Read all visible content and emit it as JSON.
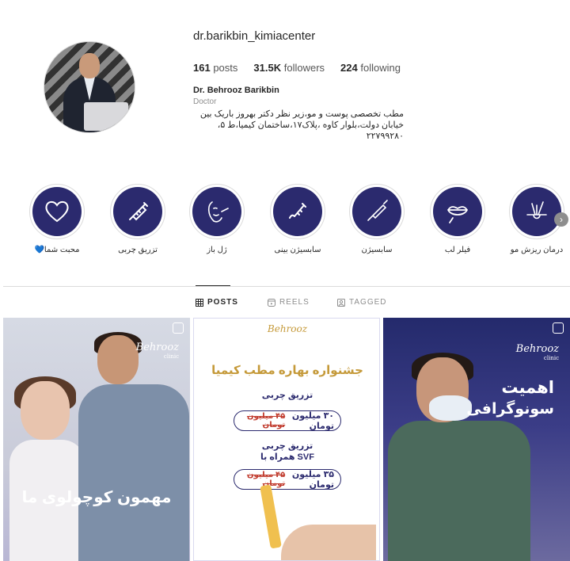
{
  "profile": {
    "username": "dr.barikbin_kimiacenter",
    "posts_count": "161",
    "posts_label": "posts",
    "followers_count": "31.5K",
    "followers_label": "followers",
    "following_count": "224",
    "following_label": "following",
    "full_name": "Dr. Behrooz Barikbin",
    "category": "Doctor",
    "bio_lines": [
      "مطب تخصصی پوست و مو،زیر نظر دکتر بهروز باریک بین",
      "خیابان دولت،بلوار کاوه ،پلاک۱۷،ساختمان کیمیا،ط ۵،",
      "۲۲۷۹۹۲۸۰"
    ]
  },
  "highlights": [
    {
      "label": "محبت شما💙",
      "icon": "heart-icon"
    },
    {
      "label": "تزریق چربی",
      "icon": "syringe-icon"
    },
    {
      "label": "ژل باز",
      "icon": "face-injection-icon"
    },
    {
      "label": "سابسیژن بینی",
      "icon": "nose-syringe-icon"
    },
    {
      "label": "سابسیژن",
      "icon": "needle-icon"
    },
    {
      "label": "فیلر لب",
      "icon": "lips-filler-icon"
    },
    {
      "label": "درمان ریزش مو",
      "icon": "hair-follicle-icon"
    }
  ],
  "tabs": {
    "posts": "POSTS",
    "reels": "REELS",
    "tagged": "TAGGED"
  },
  "posts": {
    "p1": {
      "brand": "Behrooz",
      "brand_sub": "clinic",
      "caption": "مهمون کوچولوی ما",
      "type_icon": "reel-icon"
    },
    "p2": {
      "brand": "Behrooz",
      "title": "جشنواره بهاره مطب کیمیا",
      "item1_title": "تزریق چربی",
      "item1_new": "۳۰",
      "item1_unit": "میلیون تومان",
      "item1_old": "۴۵ میلیون تومان",
      "item2_title": "تزریق چربی",
      "item2_title_b": "همراه با SVF",
      "item2_new": "۳۵",
      "item2_unit": "میلیون تومان",
      "item2_old": "۴۵ میلیون تومان"
    },
    "p3": {
      "brand": "Behrooz",
      "brand_sub": "clinic",
      "title_line1": "اهمیت",
      "title_line2": "سونوگرافی",
      "type_icon": "reel-icon"
    }
  },
  "colors": {
    "highlight_bg": "#2b2a6e",
    "accent_gold": "#c59a3a"
  }
}
